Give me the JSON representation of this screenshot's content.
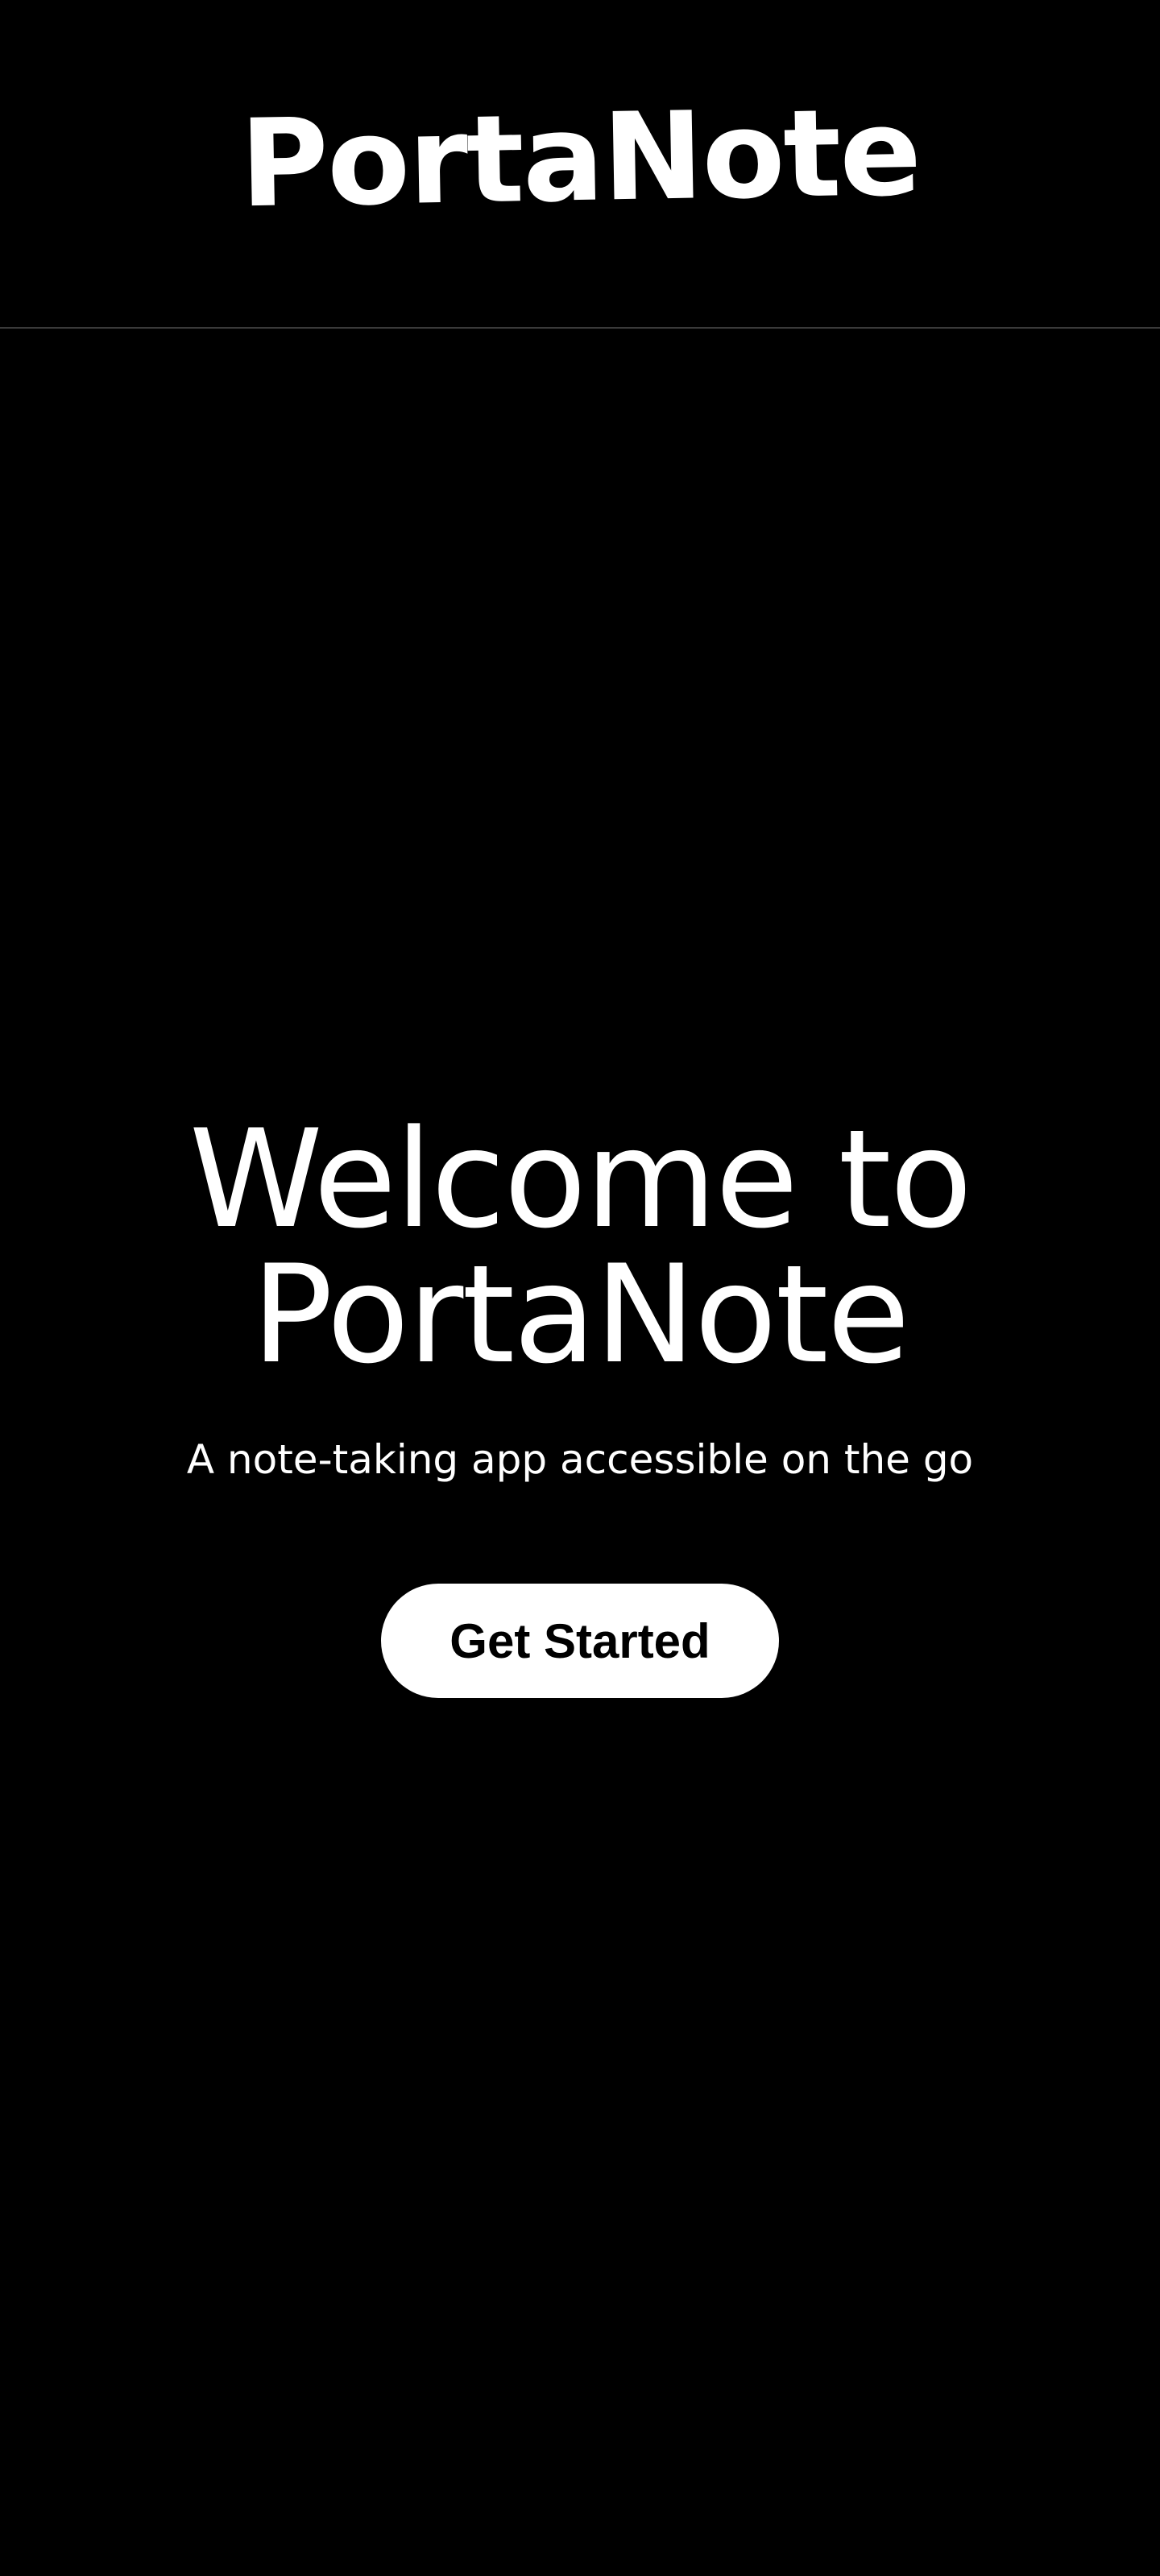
{
  "header": {
    "logo_text": "PortaNote"
  },
  "hero": {
    "title_line1": "Welcome to",
    "title_line2": "PortaNote",
    "subtitle": "A note-taking app accessible on the go",
    "cta_label": "Get Started"
  },
  "colors": {
    "background": "#000000",
    "text": "#ffffff",
    "button_background": "#ffffff",
    "button_text": "#000000",
    "divider": "#3a3a3a"
  }
}
